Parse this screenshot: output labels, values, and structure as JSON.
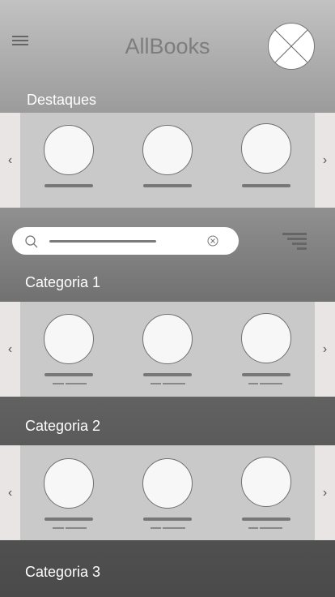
{
  "header": {
    "title": "AllBooks",
    "menu_icon": "hamburger-menu-icon",
    "avatar_icon": "placeholder-image-icon"
  },
  "featured": {
    "title": "Destaques",
    "prev_icon": "‹",
    "next_icon": "›"
  },
  "search": {
    "placeholder": "",
    "search_icon": "search-icon",
    "clear_icon": "clear-icon"
  },
  "filter": {
    "icon": "filter-icon"
  },
  "categories": [
    {
      "title": "Categoria 1",
      "prev_icon": "‹",
      "next_icon": "›"
    },
    {
      "title": "Categoria 2",
      "prev_icon": "‹",
      "next_icon": "›"
    },
    {
      "title": "Categoria 3"
    }
  ],
  "colors": {
    "carousel_bg": "#c9c9c9",
    "arrow_bg": "#e9e5e5",
    "title_gray": "#7d7d7d"
  }
}
